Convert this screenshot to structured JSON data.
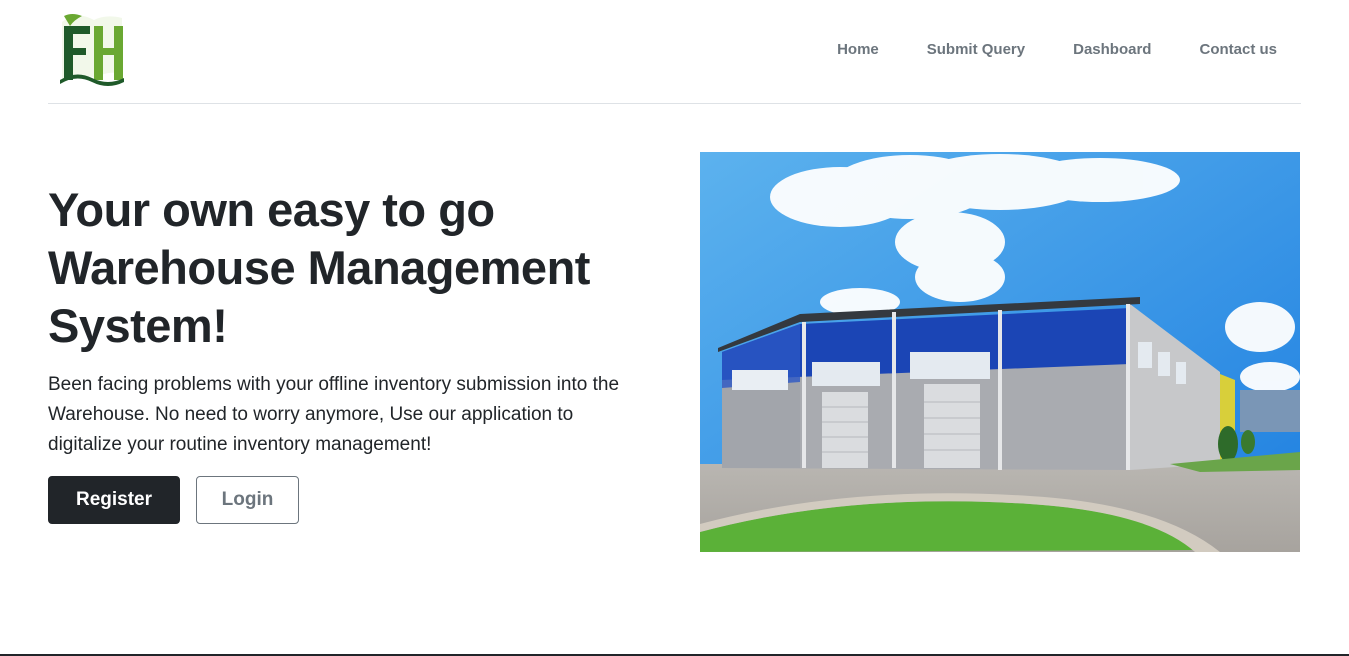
{
  "header": {
    "logo_text": "FH",
    "nav": [
      {
        "label": "Home"
      },
      {
        "label": "Submit Query"
      },
      {
        "label": "Dashboard"
      },
      {
        "label": "Contact us"
      }
    ]
  },
  "hero": {
    "title": "Your own easy to go Warehouse Management System!",
    "lead": "Been facing problems with your offline inventory submission into the Warehouse. No need to worry anymore, Use our application to digitalize your routine inventory management!",
    "register_label": "Register",
    "login_label": "Login",
    "image_subject": "warehouse-building-photo"
  },
  "colors": {
    "logo_dark_green": "#1f5a2a",
    "logo_light_green": "#6aa832",
    "primary_dark": "#212529",
    "nav_text": "#6c757d",
    "divider": "#dee2e6"
  }
}
